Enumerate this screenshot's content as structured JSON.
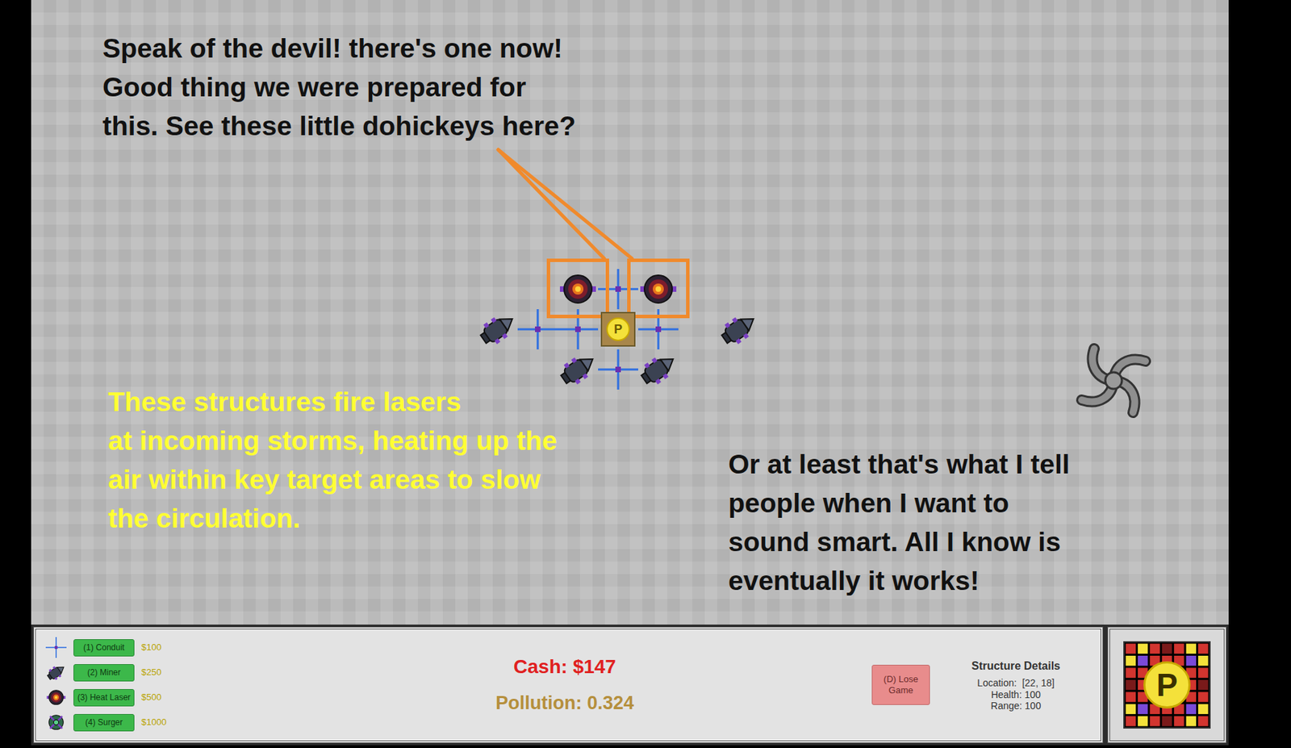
{
  "dialogs": [
    {
      "lines": [
        "Speak of the devil! there's one now!",
        "Good thing we were prepared for",
        "this. See these little dohickeys here?"
      ],
      "color": "#111111"
    },
    {
      "lines": [
        "These structures fire lasers",
        "at incoming storms, heating up the",
        "air within key target areas to slow",
        "the circulation."
      ],
      "color": "#ffff33"
    },
    {
      "lines": [
        "Or at least that's what I tell",
        "people when I want to",
        "sound smart. All I know is",
        "eventually it works!"
      ],
      "color": "#111111"
    }
  ],
  "map": {
    "base_label": "P",
    "structures": [
      {
        "kind": "conduit",
        "highlighted": false
      },
      {
        "kind": "conduit",
        "highlighted": false
      },
      {
        "kind": "conduit",
        "highlighted": false
      },
      {
        "kind": "conduit",
        "highlighted": false
      },
      {
        "kind": "conduit",
        "highlighted": false
      },
      {
        "kind": "heat-laser",
        "highlighted": true
      },
      {
        "kind": "heat-laser",
        "highlighted": true
      },
      {
        "kind": "miner",
        "highlighted": false
      },
      {
        "kind": "miner",
        "highlighted": false
      },
      {
        "kind": "miner",
        "highlighted": false
      },
      {
        "kind": "miner",
        "highlighted": false
      }
    ]
  },
  "toolbar": {
    "items": [
      {
        "kind": "conduit",
        "label": "(1) Conduit",
        "price": "$100"
      },
      {
        "kind": "miner",
        "label": "(2) Miner",
        "price": "$250"
      },
      {
        "kind": "heat-laser",
        "label": "(3) Heat Laser",
        "price": "$500"
      },
      {
        "kind": "surger",
        "label": "(4) Surger",
        "price": "$1000"
      }
    ]
  },
  "status": {
    "cash": "Cash: $147",
    "pollution": "Pollution: 0.324"
  },
  "lose_button": "(D) Lose Game",
  "structure_details": {
    "title": "Structure Details",
    "lines": [
      "Location:  [22, 18]",
      "Health: 100",
      "Range: 100"
    ]
  },
  "logo": {
    "label": "P"
  }
}
